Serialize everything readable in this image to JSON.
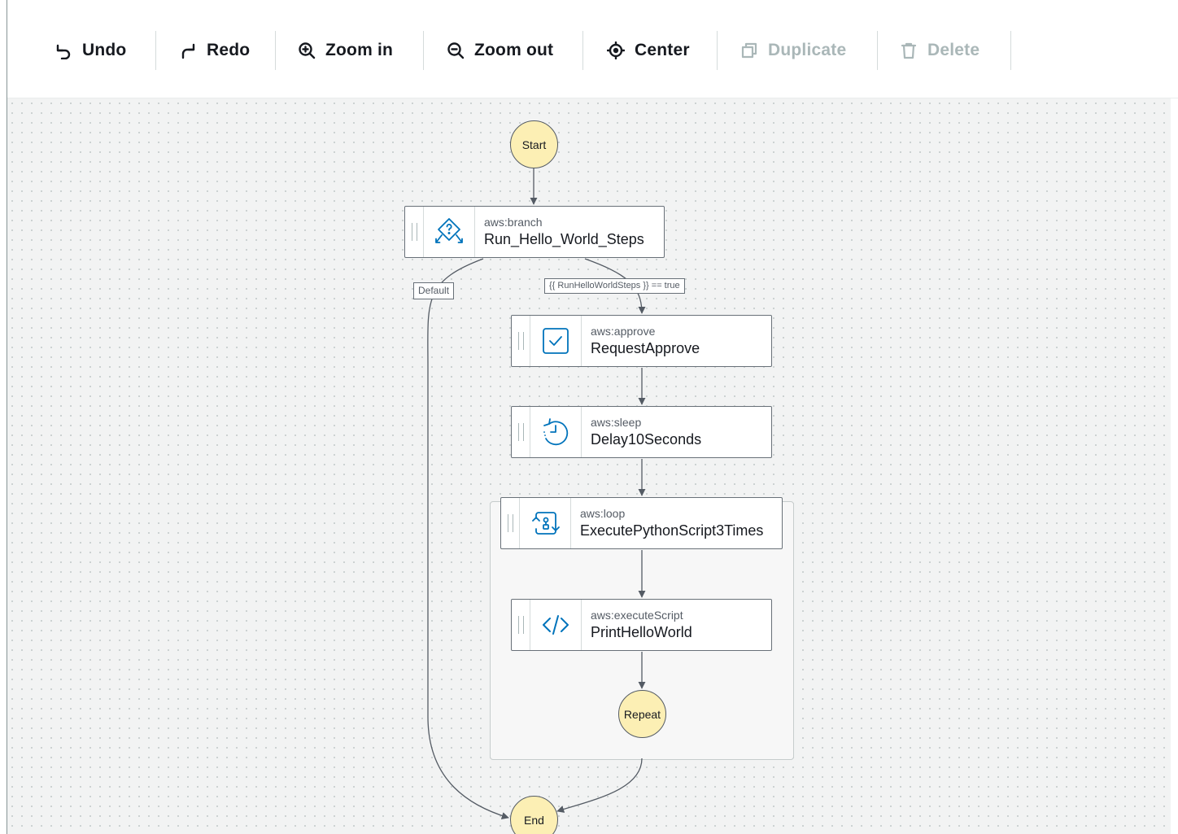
{
  "toolbar": {
    "undo": "Undo",
    "redo": "Redo",
    "zoom_in": "Zoom in",
    "zoom_out": "Zoom out",
    "center": "Center",
    "duplicate": "Duplicate",
    "delete": "Delete"
  },
  "flow": {
    "start": "Start",
    "end": "End",
    "repeat": "Repeat",
    "default_label": "Default",
    "condition_label": "{{ RunHelloWorldSteps }} == true",
    "steps": [
      {
        "type": "aws:branch",
        "name": "Run_Hello_World_Steps",
        "icon": "branch-icon"
      },
      {
        "type": "aws:approve",
        "name": "RequestApprove",
        "icon": "approve-check-icon"
      },
      {
        "type": "aws:sleep",
        "name": "Delay10Seconds",
        "icon": "sleep-timer-icon"
      },
      {
        "type": "aws:loop",
        "name": "ExecutePythonScript3Times",
        "icon": "loop-icon"
      },
      {
        "type": "aws:executeScript",
        "name": "PrintHelloWorld",
        "icon": "code-icon"
      }
    ]
  },
  "colors": {
    "accent_blue": "#0073bb",
    "terminal_fill": "#fcefb4",
    "disabled_text": "#aab7b8",
    "canvas_bg": "#f2f3f3"
  }
}
